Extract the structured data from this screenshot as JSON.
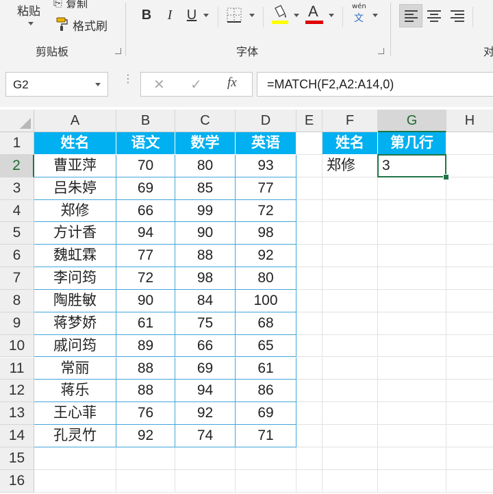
{
  "ribbon": {
    "clipboard": {
      "paste_label": "粘贴",
      "copy_label": "复制",
      "format_painter_label": "格式刷",
      "group_label": "剪贴板"
    },
    "font": {
      "bold": "B",
      "italic": "I",
      "underline": "U",
      "font_color_glyph": "A",
      "phonetic_top": "wén",
      "phonetic_bottom": "文",
      "group_label": "字体"
    },
    "alignment": {
      "group_label_partial": "对"
    },
    "colors": {
      "highlight": "#ffff00",
      "font_color": "#e00000"
    }
  },
  "formula_bar": {
    "name_box": "G2",
    "fx_label": "fx",
    "cancel_glyph": "✕",
    "enter_glyph": "✓",
    "formula": "=MATCH(F2,A2:A14,0)"
  },
  "sheet": {
    "columns": [
      "A",
      "B",
      "C",
      "D",
      "E",
      "F",
      "G",
      "H"
    ],
    "rows": [
      "1",
      "2",
      "3",
      "4",
      "5",
      "6",
      "7",
      "8",
      "9",
      "10",
      "11",
      "12",
      "13",
      "14",
      "15",
      "16"
    ],
    "selected_cell": "G2",
    "table_header": [
      "姓名",
      "语文",
      "数学",
      "英语"
    ],
    "table_rows": [
      [
        "曹亚萍",
        "70",
        "80",
        "93"
      ],
      [
        "吕朱婷",
        "69",
        "85",
        "77"
      ],
      [
        "郑修",
        "66",
        "99",
        "72"
      ],
      [
        "方计香",
        "94",
        "90",
        "98"
      ],
      [
        "魏虹霖",
        "77",
        "88",
        "92"
      ],
      [
        "李问筠",
        "72",
        "98",
        "80"
      ],
      [
        "陶胜敏",
        "90",
        "84",
        "100"
      ],
      [
        "蒋梦娇",
        "61",
        "75",
        "68"
      ],
      [
        "戚问筠",
        "89",
        "66",
        "65"
      ],
      [
        "常丽",
        "88",
        "69",
        "61"
      ],
      [
        "蒋乐",
        "88",
        "94",
        "86"
      ],
      [
        "王心菲",
        "76",
        "92",
        "69"
      ],
      [
        "孔灵竹",
        "92",
        "74",
        "71"
      ]
    ],
    "lookup_header": [
      "姓名",
      "第几行"
    ],
    "lookup_values": [
      "郑修",
      "3"
    ],
    "colors": {
      "header_fill": "#00b0f0",
      "header_text": "#ffffff",
      "table_border": "#41a6da",
      "selection": "#217346"
    }
  }
}
